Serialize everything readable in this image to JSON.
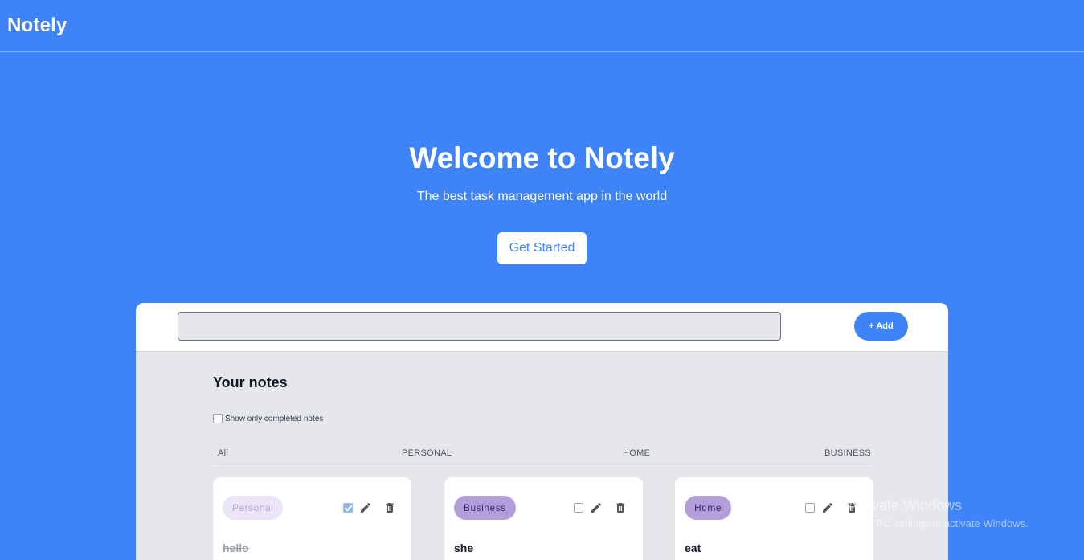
{
  "navbar": {
    "brand": "Notely"
  },
  "hero": {
    "title": "Welcome to Notely",
    "subtitle": "The best task management app in the world",
    "cta_label": "Get Started"
  },
  "composer": {
    "input_value": "",
    "add_label": "+ Add"
  },
  "notes_section": {
    "heading": "Your notes",
    "filter_label": "Show only completed notes",
    "filter_checked": false,
    "tabs": [
      {
        "label": "All"
      },
      {
        "label": "PERSONAL"
      },
      {
        "label": "HOME"
      },
      {
        "label": "BUSINESS"
      }
    ],
    "cards": [
      {
        "category": "Personal",
        "text": "hello",
        "completed": true
      },
      {
        "category": "Business",
        "text": "she",
        "completed": false
      },
      {
        "category": "Home",
        "text": "eat",
        "completed": false
      }
    ]
  },
  "icons": {
    "edit": "pencil-icon",
    "delete": "trash-icon",
    "complete": "checkbox"
  },
  "colors": {
    "primary": "#3f83f8",
    "panel": "#e5e7eb",
    "badge_personal_bg": "#ece4f7",
    "badge_active_bg": "#b39ddb"
  },
  "os_watermark": {
    "title": "Activate Windows",
    "subtitle": "Go to PC settings to activate Windows."
  }
}
